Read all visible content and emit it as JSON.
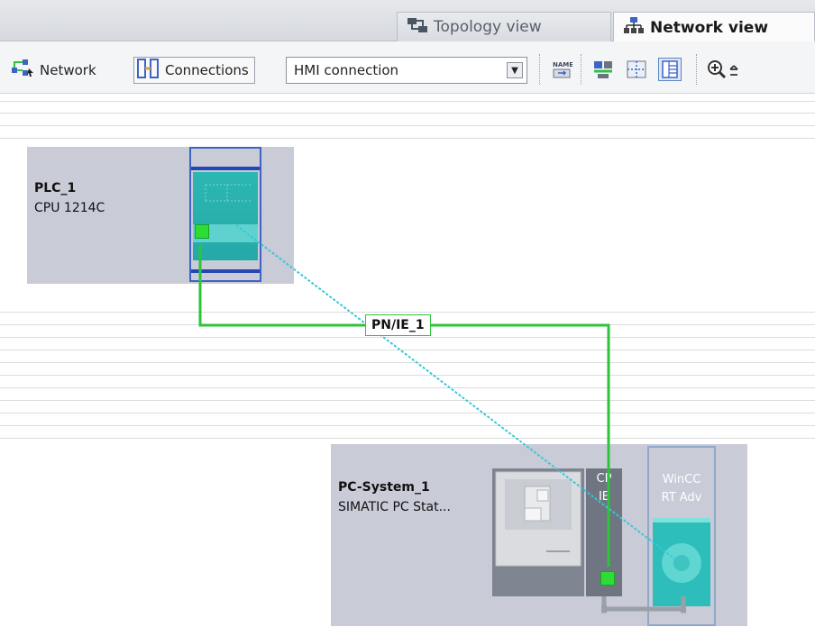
{
  "tabs": {
    "topology": "Topology view",
    "network": "Network view"
  },
  "toolbar": {
    "network_label": "Network",
    "connections_label": "Connections",
    "connection_type": "HMI connection",
    "icons": [
      "name-icon",
      "show-address-icon",
      "grid-icon",
      "table-view-icon",
      "zoom-in-icon"
    ]
  },
  "devices": {
    "plc": {
      "name": "PLC_1",
      "type": "CPU 1214C"
    },
    "pc": {
      "name": "PC-System_1",
      "type": "SIMATIC PC Stat...",
      "cp_line1": "CP",
      "cp_line2": "IE",
      "wincc_line1": "WinCC",
      "wincc_line2": "RT Adv"
    }
  },
  "subnet": {
    "label": "PN/IE_1"
  },
  "colors": {
    "profinet": "#2ec43a",
    "hmi_connection": "#37c8d9",
    "plc_highlight": "#3d63c7",
    "module": "#2cb7b3"
  }
}
